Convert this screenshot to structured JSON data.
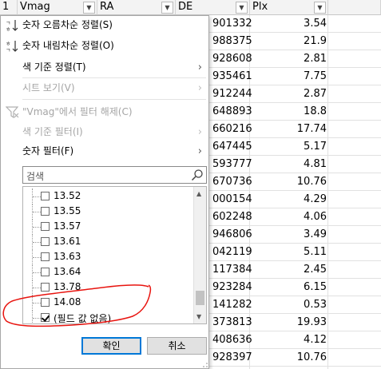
{
  "columns": {
    "col1": "1",
    "vmag": "Vmag",
    "ra": "RA",
    "de": "DE",
    "plx": "Plx"
  },
  "rows": [
    {
      "de": "901332",
      "plx": "3.54"
    },
    {
      "de": "988375",
      "plx": "21.9"
    },
    {
      "de": "928608",
      "plx": "2.81"
    },
    {
      "de": "935461",
      "plx": "7.75"
    },
    {
      "de": "912244",
      "plx": "2.87"
    },
    {
      "de": "648893",
      "plx": "18.8"
    },
    {
      "de": "660216",
      "plx": "17.74"
    },
    {
      "de": "647445",
      "plx": "5.17"
    },
    {
      "de": "593777",
      "plx": "4.81"
    },
    {
      "de": "670736",
      "plx": "10.76"
    },
    {
      "de": "000154",
      "plx": "4.29"
    },
    {
      "de": "602248",
      "plx": "4.06"
    },
    {
      "de": "946806",
      "plx": "3.49"
    },
    {
      "de": "042119",
      "plx": "5.11"
    },
    {
      "de": "117384",
      "plx": "2.45"
    },
    {
      "de": "923284",
      "plx": "6.15"
    },
    {
      "de": "141282",
      "plx": "0.53"
    },
    {
      "de": "373813",
      "plx": "19.93"
    },
    {
      "de": "408636",
      "plx": "4.12"
    },
    {
      "de": "928397",
      "plx": "10.76"
    }
  ],
  "menu": {
    "sort_asc": "숫자 오름차순 정렬(S)",
    "sort_desc": "숫자 내림차순 정렬(O)",
    "sort_by_color": "색 기준 정렬(T)",
    "sheet_view": "시트 보기(V)",
    "clear_filter": "\"Vmag\"에서 필터 해제(C)",
    "filter_by_color": "색 기준 필터(I)",
    "number_filters": "숫자 필터(F)"
  },
  "search": {
    "placeholder": "검색"
  },
  "filter_values": [
    {
      "label": "13.52",
      "checked": false
    },
    {
      "label": "13.55",
      "checked": false
    },
    {
      "label": "13.57",
      "checked": false
    },
    {
      "label": "13.61",
      "checked": false
    },
    {
      "label": "13.63",
      "checked": false
    },
    {
      "label": "13.64",
      "checked": false
    },
    {
      "label": "13.78",
      "checked": false
    },
    {
      "label": "14.08",
      "checked": false
    },
    {
      "label": "(필드 값 없음)",
      "checked": true
    }
  ],
  "buttons": {
    "ok": "확인",
    "cancel": "취소"
  },
  "colors": {
    "accent": "#0078d7",
    "annotation": "#e8140f",
    "disabled_text": "#a5a5a5"
  }
}
